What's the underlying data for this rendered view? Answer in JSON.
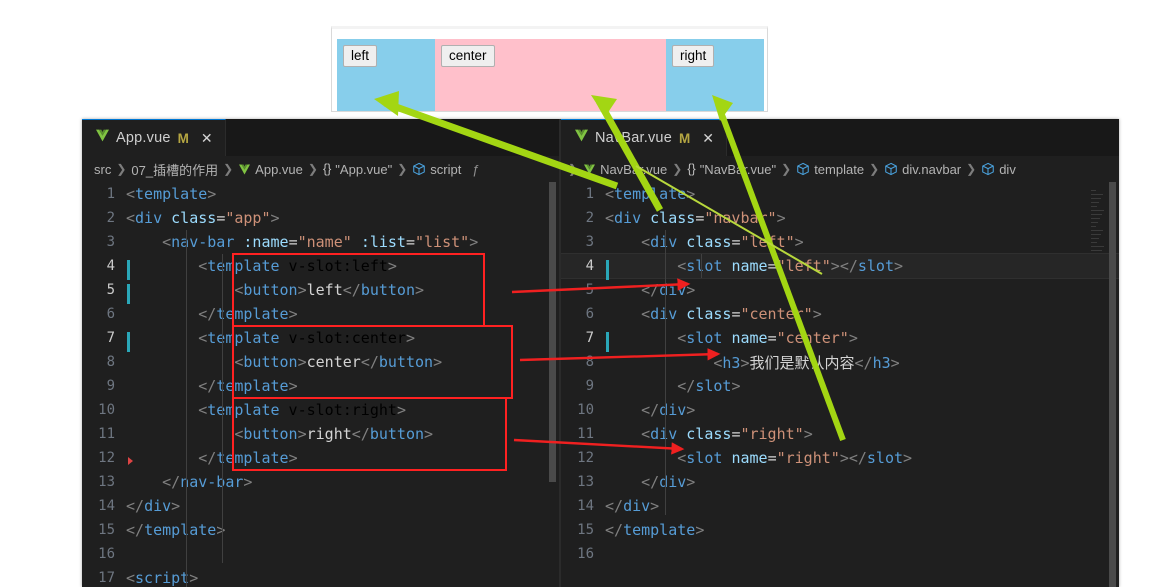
{
  "preview": {
    "name": "browser-preview",
    "sections": [
      {
        "name": "left",
        "label": "left",
        "bg": "#87ceeb"
      },
      {
        "name": "center",
        "label": "center",
        "bg": "#ffc0cb"
      },
      {
        "name": "right",
        "label": "right",
        "bg": "#87ceeb"
      }
    ]
  },
  "editor": {
    "left_pane": {
      "tab": {
        "label": "App.vue",
        "dirty_badge": "M",
        "close": "✕",
        "icon": "vue-logo-icon"
      },
      "breadcrumb": [
        {
          "text": "src",
          "icon": ""
        },
        {
          "text": "07_插槽的作用",
          "icon": ""
        },
        {
          "text": "App.vue",
          "icon": "vue-logo-icon"
        },
        {
          "text": "\"App.vue\"",
          "icon": "json-braces-icon"
        },
        {
          "text": "script",
          "icon": "symbol-cube-icon"
        },
        {
          "text": "ƒ",
          "icon": ""
        }
      ],
      "lines": [
        {
          "n": "1",
          "indent": 0,
          "text": "<template>"
        },
        {
          "n": "2",
          "indent": 0,
          "text": "<div class=\"app\">"
        },
        {
          "n": "3",
          "indent": 1,
          "text": "<nav-bar :name=\"name\" :list=\"list\">"
        },
        {
          "n": "4",
          "indent": 2,
          "text": "<template v-slot:left>"
        },
        {
          "n": "5",
          "indent": 3,
          "text": "<button>left</button>"
        },
        {
          "n": "6",
          "indent": 2,
          "text": "</template>"
        },
        {
          "n": "7",
          "indent": 2,
          "text": "<template v-slot:center>"
        },
        {
          "n": "8",
          "indent": 3,
          "text": "<button>center</button>"
        },
        {
          "n": "9",
          "indent": 2,
          "text": "</template>"
        },
        {
          "n": "10",
          "indent": 2,
          "text": "<template v-slot:right>"
        },
        {
          "n": "11",
          "indent": 3,
          "text": "<button>right</button>"
        },
        {
          "n": "12",
          "indent": 2,
          "text": "</template>"
        },
        {
          "n": "13",
          "indent": 1,
          "text": "</nav-bar>"
        },
        {
          "n": "14",
          "indent": 0,
          "text": "</div>"
        },
        {
          "n": "15",
          "indent": 0,
          "text": "</template>"
        },
        {
          "n": "16",
          "indent": 0,
          "text": ""
        },
        {
          "n": "17",
          "indent": 0,
          "text": "<script>"
        }
      ],
      "cursor_lines": [
        "4",
        "5",
        "7"
      ],
      "fold_marker_line": "12"
    },
    "right_pane": {
      "tab": {
        "label": "NavBar.vue",
        "dirty_badge": "M",
        "close": "✕",
        "icon": "vue-logo-icon"
      },
      "breadcrumb": [
        {
          "text": "NavBar.vue",
          "icon": "vue-logo-icon"
        },
        {
          "text": "\"NavBar.vue\"",
          "icon": "json-braces-icon"
        },
        {
          "text": "template",
          "icon": "symbol-cube-icon"
        },
        {
          "text": "div.navbar",
          "icon": "symbol-cube-icon"
        },
        {
          "text": "div",
          "icon": "symbol-cube-icon"
        }
      ],
      "lines": [
        {
          "n": "1",
          "indent": 0,
          "text": "<template>"
        },
        {
          "n": "2",
          "indent": 0,
          "text": "<div class=\"navbar\">"
        },
        {
          "n": "3",
          "indent": 1,
          "text": "<div class=\"left\">"
        },
        {
          "n": "4",
          "indent": 2,
          "text": "<slot name=\"left\"></slot>"
        },
        {
          "n": "5",
          "indent": 1,
          "text": "</div>"
        },
        {
          "n": "6",
          "indent": 1,
          "text": "<div class=\"center\">"
        },
        {
          "n": "7",
          "indent": 2,
          "text": "<slot name=\"center\">"
        },
        {
          "n": "8",
          "indent": 3,
          "text": "<h3>我们是默认内容</h3>"
        },
        {
          "n": "9",
          "indent": 2,
          "text": "</slot>"
        },
        {
          "n": "10",
          "indent": 1,
          "text": "</div>"
        },
        {
          "n": "11",
          "indent": 1,
          "text": "<div class=\"right\">"
        },
        {
          "n": "12",
          "indent": 2,
          "text": "<slot name=\"right\"></slot>"
        },
        {
          "n": "13",
          "indent": 1,
          "text": "</div>"
        },
        {
          "n": "14",
          "indent": 0,
          "text": "</div>"
        },
        {
          "n": "15",
          "indent": 0,
          "text": "</template>"
        },
        {
          "n": "16",
          "indent": 0,
          "text": ""
        }
      ],
      "cursor_lines": [
        "4",
        "7"
      ],
      "active_line": "4"
    }
  },
  "annotations": {
    "red_boxes": [
      {
        "name": "slot-left-template-box",
        "label": "v-slot:left block"
      },
      {
        "name": "slot-center-template-box",
        "label": "v-slot:center block"
      },
      {
        "name": "slot-right-template-box",
        "label": "v-slot:right block"
      }
    ],
    "red_arrows": [
      {
        "name": "arrow-left-to-slot-left",
        "from": "v-slot:left block",
        "to": "slot name=\"left\""
      },
      {
        "name": "arrow-center-to-slot-center",
        "from": "v-slot:center block",
        "to": "slot name=\"center\""
      },
      {
        "name": "arrow-right-to-slot-right",
        "from": "v-slot:right block",
        "to": "div class=\"right\""
      }
    ],
    "green_arrows": [
      {
        "name": "arrow-slot-left-to-preview-left",
        "to": "preview left section"
      },
      {
        "name": "arrow-slot-center-to-preview-center",
        "to": "preview center section"
      },
      {
        "name": "arrow-slot-right-to-preview-right",
        "to": "preview right section"
      }
    ],
    "colors": {
      "red": "#ff2121",
      "green": "#a3d613",
      "cursor": "#2aa7b8"
    }
  }
}
